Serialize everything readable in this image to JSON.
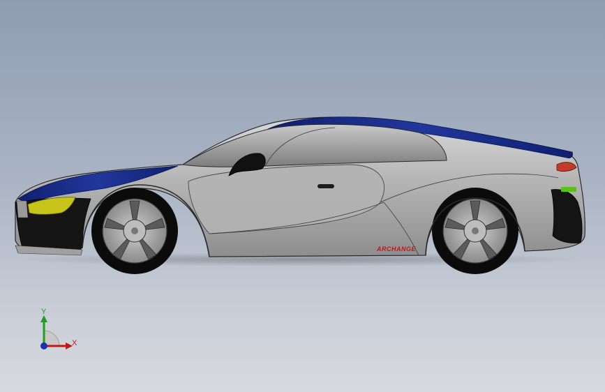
{
  "viewport": {
    "background_top": "#8f9db2",
    "background_bottom": "#d7dade"
  },
  "model": {
    "body_color": "#b9b9b9",
    "stripe_color": "#1a2f8a",
    "headlight_color": "#c7c41b",
    "taillight_color": "#c23b2a",
    "side_badge_text": "ARCHANGE"
  },
  "triad": {
    "y_label": "Y",
    "x_label": "X",
    "y_color": "#1f9d1f",
    "x_color": "#c21818",
    "z_color": "#1f2fb0"
  }
}
